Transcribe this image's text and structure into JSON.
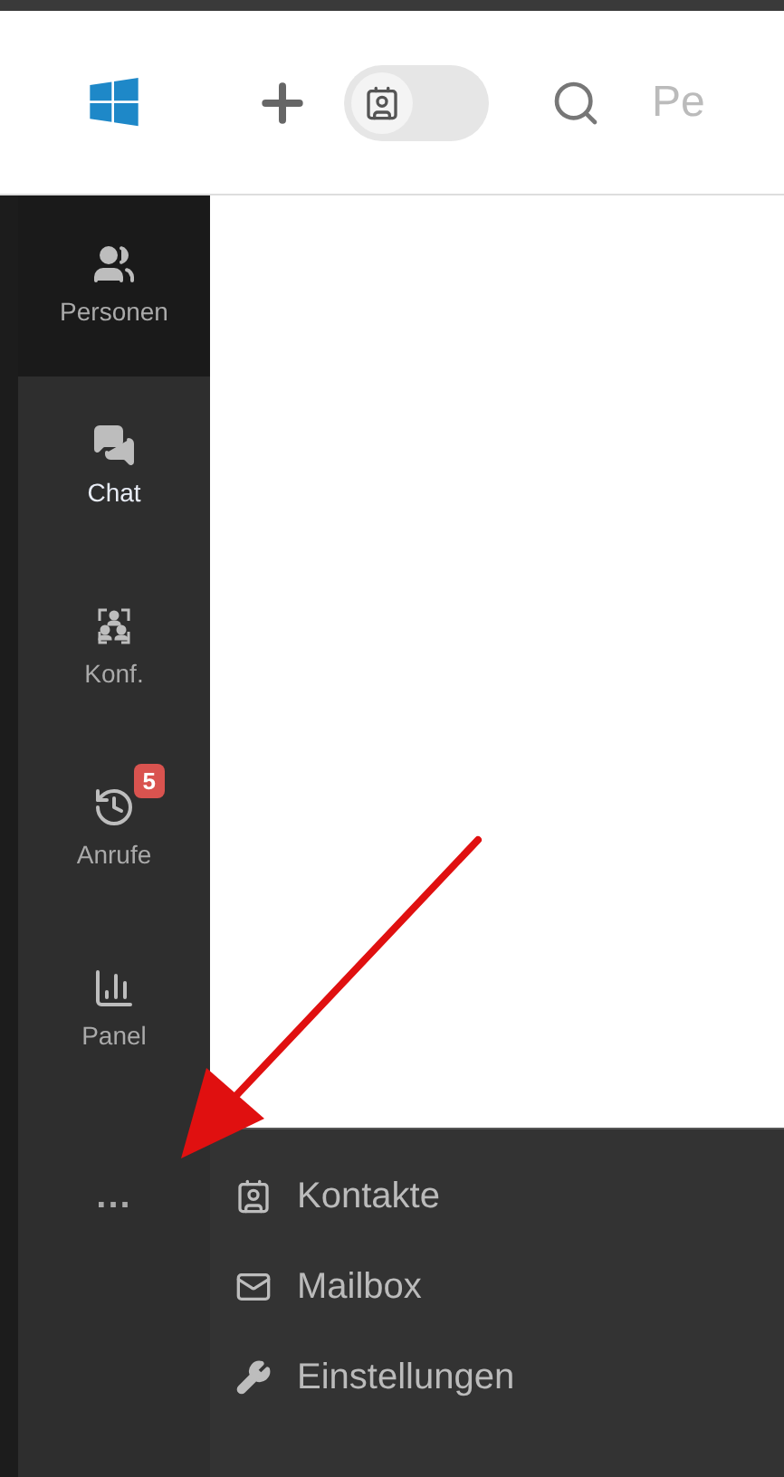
{
  "toolbar": {
    "contacts_toggle": {
      "on": false
    },
    "search": {
      "placeholder": "Pe"
    }
  },
  "sidebar": {
    "items": [
      {
        "label": "Personen",
        "kind": "people",
        "selected": true,
        "highlighted": false
      },
      {
        "label": "Chat",
        "kind": "chat",
        "selected": false,
        "highlighted": true
      },
      {
        "label": "Konf.",
        "kind": "conference",
        "selected": false,
        "highlighted": false
      },
      {
        "label": "Anrufe",
        "kind": "calls",
        "selected": false,
        "highlighted": false,
        "badge": "5"
      },
      {
        "label": "Panel",
        "kind": "panel",
        "selected": false,
        "highlighted": false
      }
    ],
    "more": "..."
  },
  "more_menu": {
    "items": [
      {
        "label": "Kontakte",
        "kind": "contacts"
      },
      {
        "label": "Mailbox",
        "kind": "mail"
      },
      {
        "label": "Einstellungen",
        "kind": "settings"
      }
    ]
  }
}
